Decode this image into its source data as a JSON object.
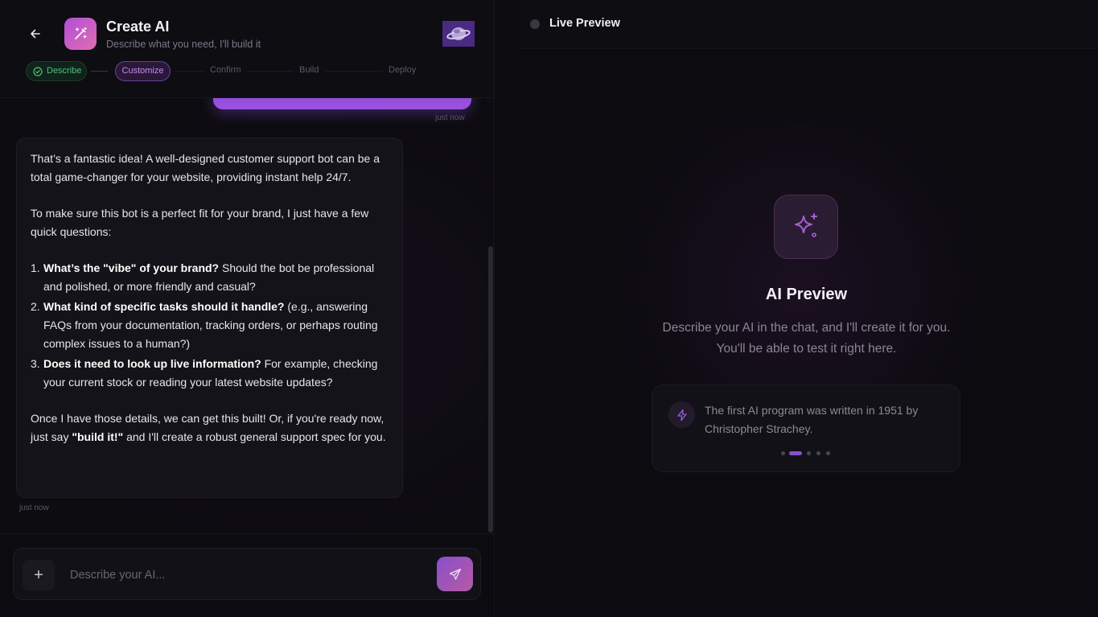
{
  "header": {
    "title": "Create AI",
    "subtitle": "Describe what you need, I'll build it"
  },
  "steps": [
    {
      "label": "Describe",
      "state": "done"
    },
    {
      "label": "Customize",
      "state": "active"
    },
    {
      "label": "Confirm",
      "state": "pending"
    },
    {
      "label": "Build",
      "state": "pending"
    },
    {
      "label": "Deploy",
      "state": "pending"
    }
  ],
  "chat": {
    "user_timestamp": "just now",
    "ai_timestamp": "just now",
    "ai_message": {
      "intro": "That’s a fantastic idea! A well-designed customer support bot can be a total game-changer for your website, providing instant help 24/7.",
      "lead": "To make sure this bot is a perfect fit for your brand, I just have a few quick questions:",
      "questions": [
        {
          "num": "1.",
          "bold": "What’s the \"vibe\" of your brand?",
          "rest": " Should the bot be professional and polished, or more friendly and casual?"
        },
        {
          "num": "2.",
          "bold": "What kind of specific tasks should it handle?",
          "rest": " (e.g., answering FAQs from your documentation, tracking orders, or perhaps routing complex issues to a human?)"
        },
        {
          "num": "3.",
          "bold": "Does it need to look up live information?",
          "rest": " For example, checking your current stock or reading your latest website updates?"
        }
      ],
      "outro_before": "Once I have those details, we can get this built! Or, if you're ready now, just say ",
      "outro_bold": "\"build it!\"",
      "outro_after": " and I'll create a robust general support spec for you."
    }
  },
  "composer": {
    "placeholder": "Describe your AI...",
    "add_label": "+"
  },
  "preview": {
    "header_title": "Live Preview",
    "title": "AI Preview",
    "description": "Describe your AI in the chat, and I'll create it for you. You'll be able to test it right here.",
    "fact": "The first AI program was written in 1951 by Christopher Strachey.",
    "carousel_active_index": 1,
    "carousel_count": 5
  },
  "colors": {
    "accent": "#9b52e0",
    "done_green": "#4cc27a",
    "background": "#0c0b10"
  },
  "icons": [
    "back-arrow-icon",
    "magic-wand-icon",
    "check-circle-icon",
    "plus-icon",
    "send-icon",
    "sparkle-icon",
    "lightning-icon"
  ]
}
